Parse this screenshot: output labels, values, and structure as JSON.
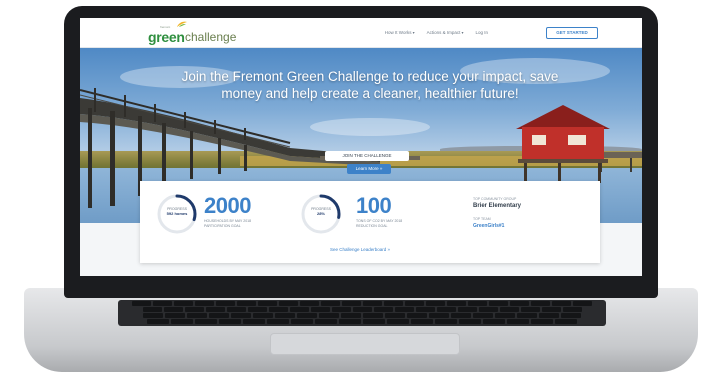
{
  "nav": {
    "brand_word1": "green",
    "brand_word2": "challenge",
    "brand_small": "fremont",
    "links": [
      "How It Works",
      "Actions & Impact",
      "Log In"
    ],
    "cta_label": "GET STARTED"
  },
  "hero": {
    "headline": "Join the Fremont Green Challenge to reduce your impact, save money and help create a cleaner, healthier future!",
    "join_button": "JOIN THE CHALLENGE",
    "learn_button": "Learn More »"
  },
  "stats": {
    "households": {
      "ring_label": "PROGRESS",
      "ring_value": "592 homes",
      "ring_fraction": 0.3,
      "number": "2000",
      "caption": "HOUSEHOLDS BY MAY 2018 PARTICIPATION GOAL"
    },
    "co2": {
      "ring_label": "PROGRESS",
      "ring_value": "28%",
      "ring_fraction": 0.28,
      "number": "100",
      "caption": "TONS OF CO2 BY MAY 2018 REDUCTION GOAL"
    },
    "top_group": {
      "label": "TOP COMMUNITY GROUP",
      "value": "Brier Elementary"
    },
    "top_team": {
      "label": "TOP TEAM",
      "value": "GreenGirls#1"
    },
    "leaderboard_link": "See Challenge Leaderboard »"
  },
  "colors": {
    "accent_blue": "#3d82c9",
    "ring_navy": "#1f3a6b",
    "brand_green": "#2f8f3f"
  }
}
